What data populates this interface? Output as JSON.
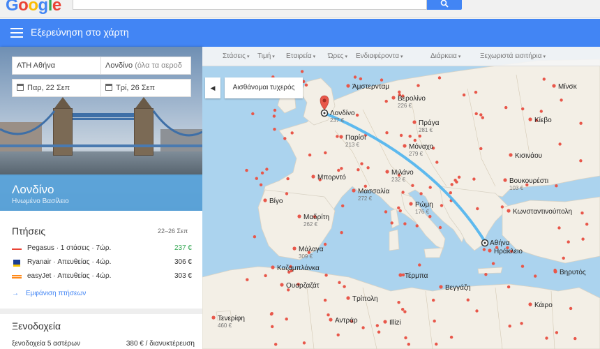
{
  "google": {
    "logo_letters": [
      "G",
      "o",
      "o",
      "g",
      "l",
      "e"
    ]
  },
  "appbar": {
    "title": "Εξερεύνηση στο χάρτη"
  },
  "search": {
    "origin": "ΑΤΗ Αθήνα",
    "destination": "Λονδίνο",
    "destination_hint": "(όλα τα αεροδ",
    "depart_date": "Παρ, 22 Σεπ",
    "return_date": "Τρί, 26 Σεπ"
  },
  "destination": {
    "city": "Λονδίνο",
    "country": "Ηνωμένο Βασίλειο"
  },
  "flights": {
    "title": "Πτήσεις",
    "dates": "22–26 Σεπ",
    "rows": [
      {
        "airline": "Pegasus · 1 στάσεις · 7ώρ.",
        "price": "237 €",
        "icon": "pegasus-icon",
        "color": "#ea4335",
        "price_color": "#34a853"
      },
      {
        "airline": "Ryanair · Απευθείας · 4ώρ.",
        "price": "306 €",
        "icon": "ryanair-icon",
        "color": "#1b3f94",
        "price_color": "#333333"
      },
      {
        "airline": "easyJet · Απευθείας · 4ώρ.",
        "price": "303 €",
        "icon": "easyjet-icon",
        "color": "#ff8a1a",
        "price_color": "#333333"
      }
    ],
    "show_more": "Εμφάνιση πτήσεων"
  },
  "hotels": {
    "title": "Ξενοδοχεία",
    "row_label": "ξενοδοχεία 5 αστέρων",
    "row_price": "380 € / διανυκτέρευση"
  },
  "filters": [
    "Στάσεις",
    "Τιμή",
    "Εταιρεία",
    "Ώρες",
    "Ενδιαφέροντα",
    "Διάρκεια",
    "Ξεχωριστά εισιτήρια"
  ],
  "map": {
    "lucky_button": "Αισθάνομαι τυχερός",
    "cities": [
      {
        "name": "Λονδίνο",
        "price": "237 €"
      },
      {
        "name": "Παρίσι",
        "price": "213 €"
      },
      {
        "name": "Άμστερνταμ",
        "price": ""
      },
      {
        "name": "Βερολίνο",
        "price": "226 €"
      },
      {
        "name": "Πράγα",
        "price": "281 €"
      },
      {
        "name": "Μόναχο",
        "price": "279 €"
      },
      {
        "name": "Μιλάνο",
        "price": "232 €"
      },
      {
        "name": "Μασσαλία",
        "price": "272 €"
      },
      {
        "name": "Ρώμη",
        "price": "176 €"
      },
      {
        "name": "Μπορντό",
        "price": ""
      },
      {
        "name": "Βίγο",
        "price": ""
      },
      {
        "name": "Μαδρίτη",
        "price": "262 €"
      },
      {
        "name": "Μάλαγα",
        "price": "309 €"
      },
      {
        "name": "Καζαμπλάνκα",
        "price": ""
      },
      {
        "name": "Ουαρζαζάτ",
        "price": ""
      },
      {
        "name": "Τενερίφη",
        "price": "460 €"
      },
      {
        "name": "Αντράρ",
        "price": ""
      },
      {
        "name": "Illizi",
        "price": ""
      },
      {
        "name": "Τέρμπα",
        "price": ""
      },
      {
        "name": "Τρίπολη",
        "price": ""
      },
      {
        "name": "Βεγγάζη",
        "price": ""
      },
      {
        "name": "Αθήνα",
        "price": ""
      },
      {
        "name": "Ηράκλειο",
        "price": ""
      },
      {
        "name": "Κάιρο",
        "price": ""
      },
      {
        "name": "Βηρυτός",
        "price": ""
      },
      {
        "name": "Κωνσταντινούπολη",
        "price": ""
      },
      {
        "name": "Βουκουρέστι",
        "price": "103 €"
      },
      {
        "name": "Κισινάου",
        "price": ""
      },
      {
        "name": "Κίεβο",
        "price": ""
      },
      {
        "name": "Μίνσκ",
        "price": ""
      }
    ],
    "route_color": "#4db3ee",
    "land_color": "#f3efe6",
    "sea_color": "#abd3ee",
    "dot_color": "#e8574a"
  }
}
